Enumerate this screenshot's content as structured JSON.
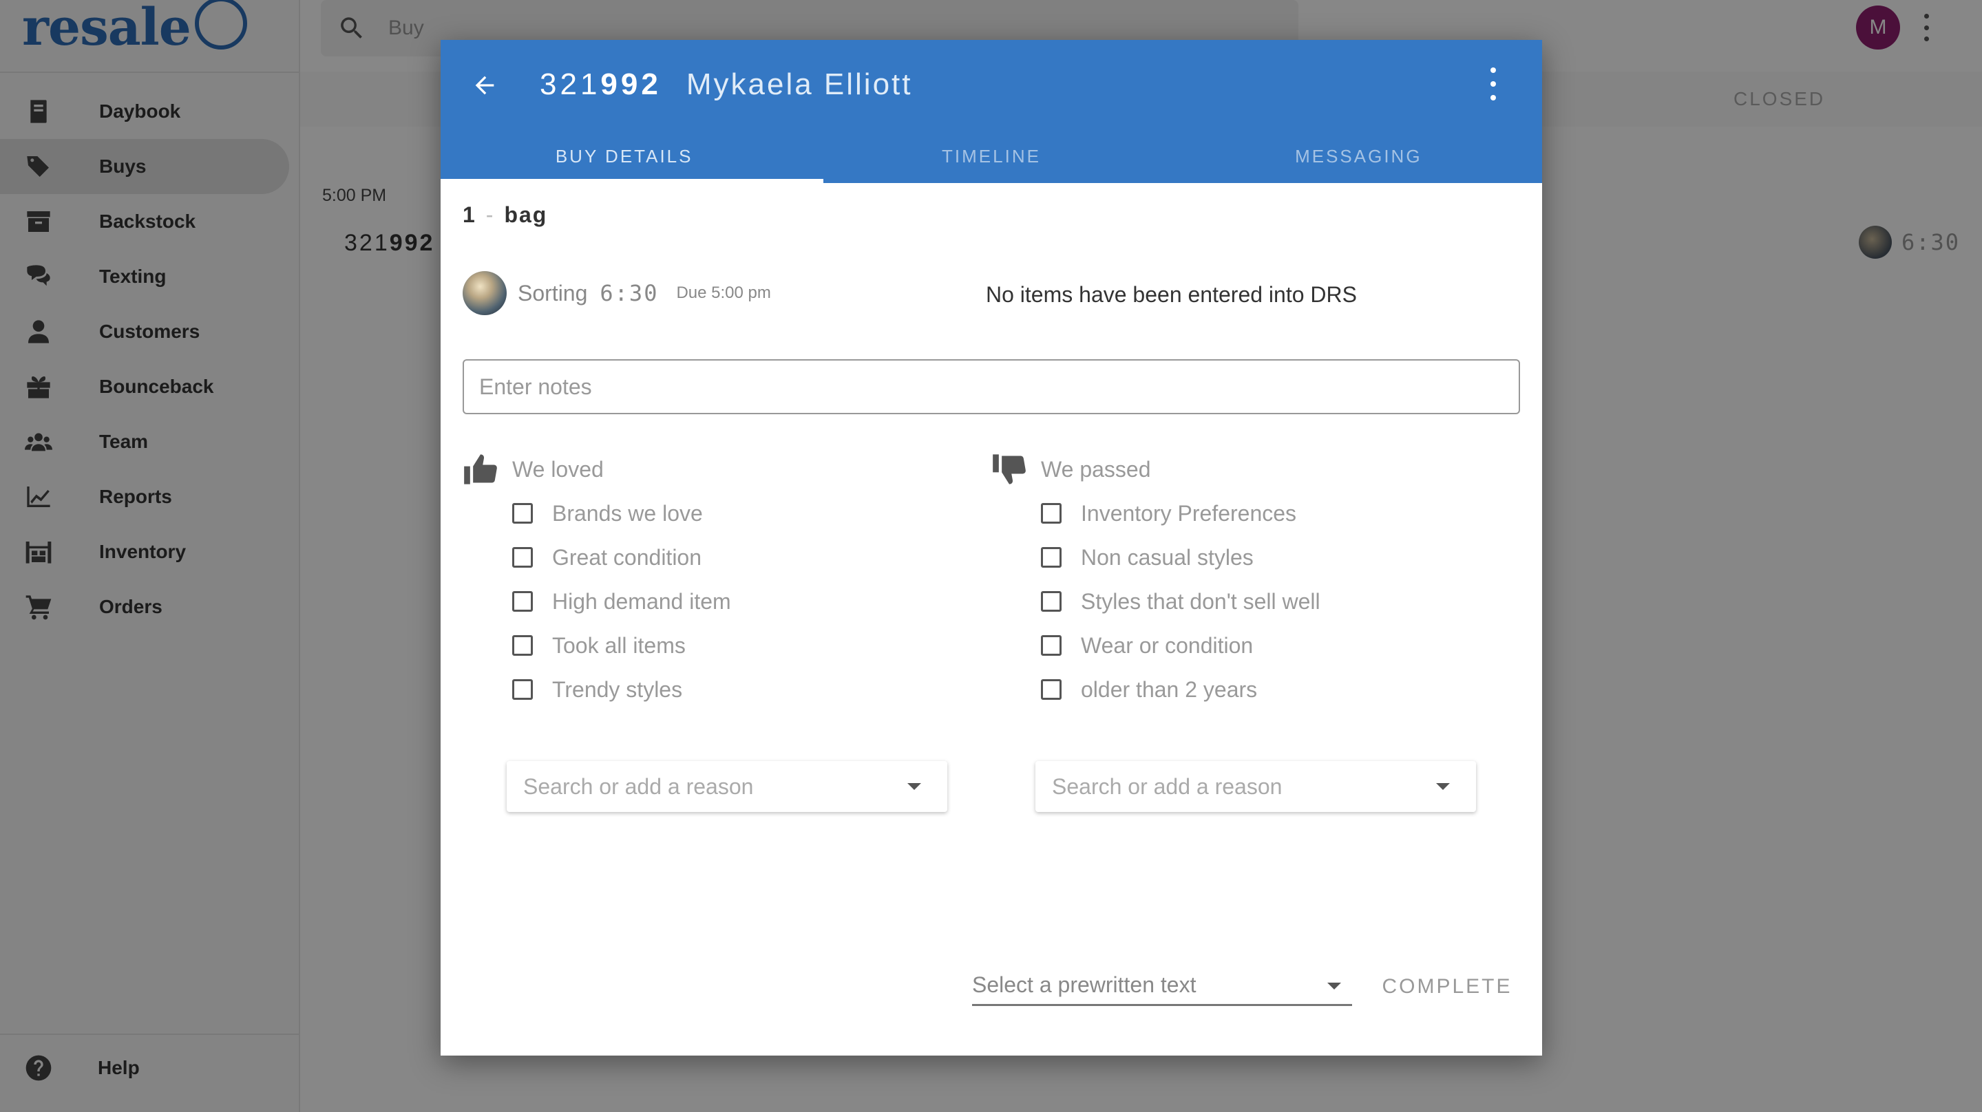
{
  "app": {
    "logo_text": "resale",
    "search_placeholder": "Buy",
    "avatar_initial": "M",
    "avatar_color": "#8e1f6e",
    "brand_color": "#3578c4"
  },
  "sidebar": {
    "items": [
      {
        "label": "Daybook",
        "icon": "book-icon"
      },
      {
        "label": "Buys",
        "icon": "tags-icon",
        "active": true
      },
      {
        "label": "Backstock",
        "icon": "archive-icon"
      },
      {
        "label": "Texting",
        "icon": "chat-icon"
      },
      {
        "label": "Customers",
        "icon": "person-icon"
      },
      {
        "label": "Bounceback",
        "icon": "gift-icon"
      },
      {
        "label": "Team",
        "icon": "group-icon"
      },
      {
        "label": "Reports",
        "icon": "chart-icon"
      },
      {
        "label": "Inventory",
        "icon": "warehouse-icon"
      },
      {
        "label": "Orders",
        "icon": "cart-icon"
      }
    ],
    "help_label": "Help"
  },
  "background": {
    "closed_tab": "CLOSED",
    "time": "5:00 PM",
    "buy_number_prefix": "321",
    "buy_number_bold": "992",
    "timer": "6:30"
  },
  "dialog": {
    "number_prefix": "321",
    "number_bold": "992",
    "customer_name": "Mykaela Elliott",
    "tabs": [
      {
        "label": "BUY DETAILS",
        "active": true
      },
      {
        "label": "TIMELINE"
      },
      {
        "label": "MESSAGING"
      }
    ],
    "bag_count": "1",
    "bag_separator": "-",
    "bag_unit": "bag",
    "status": "Sorting",
    "timer": "6:30",
    "due": "Due 5:00 pm",
    "drs_message": "No items have been entered into DRS",
    "notes_placeholder": "Enter notes",
    "loved": {
      "heading": "We loved",
      "options": [
        "Brands we love",
        "Great condition",
        "High demand item",
        "Took all items",
        "Trendy styles"
      ],
      "reason_placeholder": "Search or add a reason"
    },
    "passed": {
      "heading": "We passed",
      "options": [
        "Inventory Preferences",
        "Non casual styles",
        "Styles that don't sell well",
        "Wear or condition",
        "older than 2 years"
      ],
      "reason_placeholder": "Search or add a reason"
    },
    "prewritten_placeholder": "Select a prewritten text",
    "complete_label": "COMPLETE"
  }
}
